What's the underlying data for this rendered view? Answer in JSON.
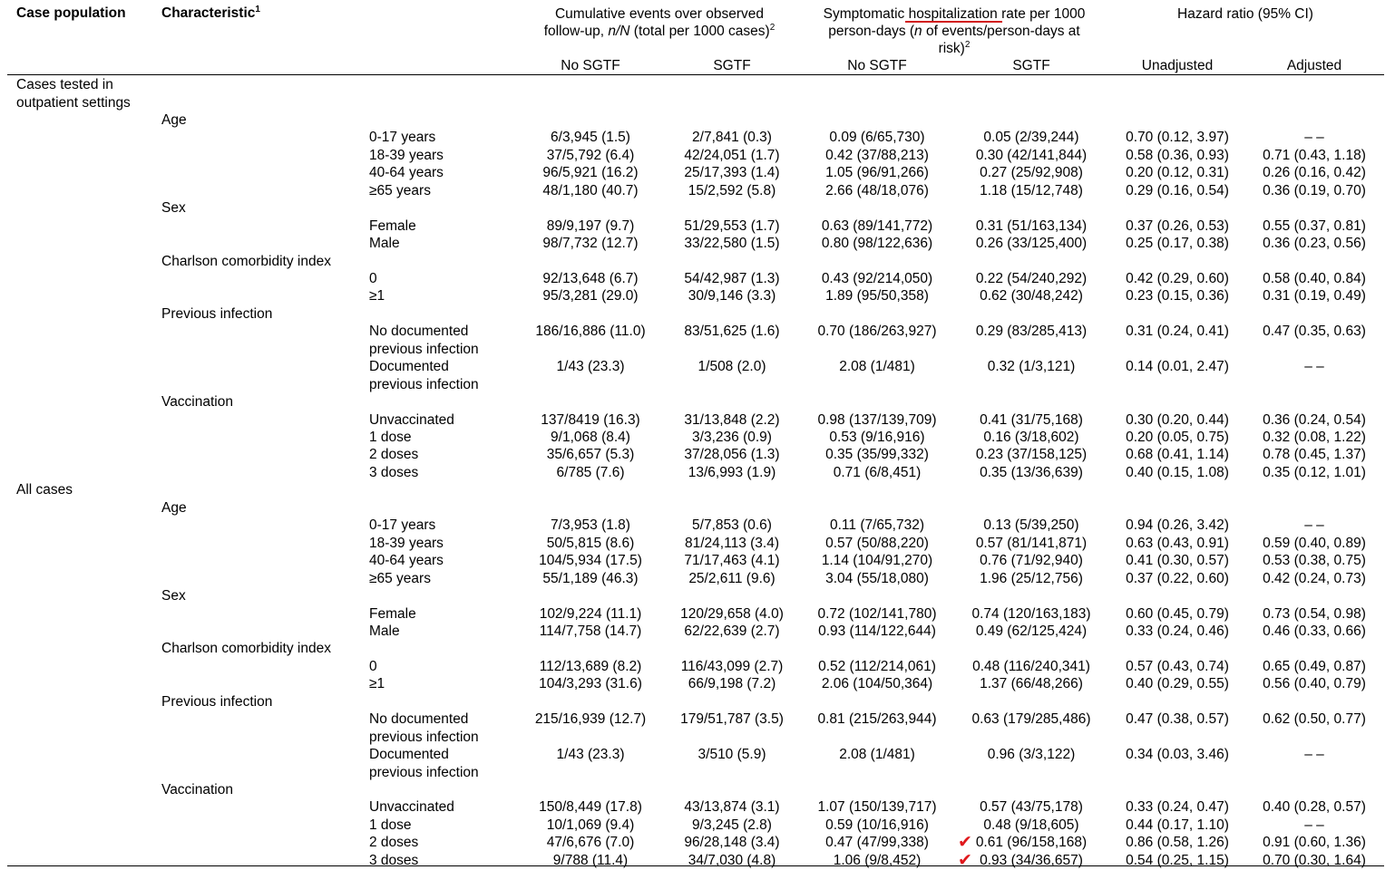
{
  "header": {
    "case_population": "Case population",
    "characteristic": "Characteristic",
    "characteristic_sup": "1",
    "cumulative_line1": "Cumulative events over observed",
    "cumulative_line2a": "follow-up, ",
    "cumulative_line2b": "n/N",
    "cumulative_line2c": " (total per 1000 cases)",
    "cumulative_sup": "2",
    "symp_line1a": "Symptomatic ",
    "symp_line1b": "hospitalization",
    "symp_line1c": " rate per 1000",
    "symp_line2a": "person-days (",
    "symp_line2b": "n",
    "symp_line2c": " of events/person-days at",
    "symp_line3": "risk)",
    "symp_sup": "2",
    "hazard": "Hazard ratio (95% CI)",
    "sub_no_sgtf_1": "No SGTF",
    "sub_sgtf_1": "SGTF",
    "sub_no_sgtf_2": "No SGTF",
    "sub_sgtf_2": "SGTF",
    "sub_unadjusted": "Unadjusted",
    "sub_adjusted": "Adjusted"
  },
  "rows": [
    {
      "pop": [
        "Cases tested in",
        "outpatient settings"
      ]
    },
    {
      "group": "Age"
    },
    {
      "level": [
        "0-17 years"
      ],
      "v": [
        "6/3,945 (1.5)",
        "2/7,841 (0.3)",
        "0.09 (6/65,730)",
        "0.05 (2/39,244)",
        "0.70 (0.12, 3.97)",
        "– –"
      ]
    },
    {
      "level": [
        "18-39 years"
      ],
      "v": [
        "37/5,792 (6.4)",
        "42/24,051 (1.7)",
        "0.42 (37/88,213)",
        "0.30 (42/141,844)",
        "0.58 (0.36, 0.93)",
        "0.71 (0.43, 1.18)"
      ]
    },
    {
      "level": [
        "40-64 years"
      ],
      "v": [
        "96/5,921 (16.2)",
        "25/17,393 (1.4)",
        "1.05 (96/91,266)",
        "0.27 (25/92,908)",
        "0.20 (0.12, 0.31)",
        "0.26 (0.16, 0.42)"
      ]
    },
    {
      "level": [
        "≥65 years"
      ],
      "v": [
        "48/1,180 (40.7)",
        "15/2,592 (5.8)",
        "2.66 (48/18,076)",
        "1.18 (15/12,748)",
        "0.29 (0.16, 0.54)",
        "0.36 (0.19, 0.70)"
      ]
    },
    {
      "group": "Sex"
    },
    {
      "level": [
        "Female"
      ],
      "v": [
        "89/9,197 (9.7)",
        "51/29,553 (1.7)",
        "0.63 (89/141,772)",
        "0.31 (51/163,134)",
        "0.37 (0.26, 0.53)",
        "0.55 (0.37, 0.81)"
      ]
    },
    {
      "level": [
        "Male"
      ],
      "v": [
        "98/7,732 (12.7)",
        "33/22,580 (1.5)",
        "0.80 (98/122,636)",
        "0.26 (33/125,400)",
        "0.25 (0.17, 0.38)",
        "0.36 (0.23, 0.56)"
      ]
    },
    {
      "group": "Charlson comorbidity index"
    },
    {
      "level": [
        "0"
      ],
      "v": [
        "92/13,648 (6.7)",
        "54/42,987 (1.3)",
        "0.43 (92/214,050)",
        "0.22 (54/240,292)",
        "0.42 (0.29, 0.60)",
        "0.58 (0.40, 0.84)"
      ]
    },
    {
      "level": [
        "≥1"
      ],
      "v": [
        "95/3,281 (29.0)",
        "30/9,146 (3.3)",
        "1.89 (95/50,358)",
        "0.62 (30/48,242)",
        "0.23 (0.15, 0.36)",
        "0.31 (0.19, 0.49)"
      ]
    },
    {
      "group": "Previous infection"
    },
    {
      "level": [
        "No documented",
        "previous infection"
      ],
      "v": [
        "186/16,886 (11.0)",
        "83/51,625 (1.6)",
        "0.70 (186/263,927)",
        "0.29 (83/285,413)",
        "0.31 (0.24, 0.41)",
        "0.47 (0.35, 0.63)"
      ]
    },
    {
      "level": [
        "Documented",
        "previous infection"
      ],
      "v": [
        "1/43 (23.3)",
        "1/508 (2.0)",
        "2.08 (1/481)",
        "0.32 (1/3,121)",
        "0.14 (0.01, 2.47)",
        "– –"
      ]
    },
    {
      "group": "Vaccination"
    },
    {
      "level": [
        "Unvaccinated"
      ],
      "v": [
        "137/8419 (16.3)",
        "31/13,848 (2.2)",
        "0.98 (137/139,709)",
        "0.41 (31/75,168)",
        "0.30 (0.20, 0.44)",
        "0.36 (0.24, 0.54)"
      ]
    },
    {
      "level": [
        "1 dose"
      ],
      "v": [
        "9/1,068 (8.4)",
        "3/3,236 (0.9)",
        "0.53 (9/16,916)",
        "0.16 (3/18,602)",
        "0.20 (0.05, 0.75)",
        "0.32 (0.08, 1.22)"
      ]
    },
    {
      "level": [
        "2 doses"
      ],
      "v": [
        "35/6,657 (5.3)",
        "37/28,056 (1.3)",
        "0.35 (35/99,332)",
        "0.23 (37/158,125)",
        "0.68 (0.41, 1.14)",
        "0.78 (0.45, 1.37)"
      ]
    },
    {
      "level": [
        "3 doses"
      ],
      "v": [
        "6/785 (7.6)",
        "13/6,993 (1.9)",
        "0.71 (6/8,451)",
        "0.35 (13/36,639)",
        "0.40 (0.15, 1.08)",
        "0.35 (0.12, 1.01)"
      ]
    },
    {
      "pop": [
        "All cases"
      ]
    },
    {
      "group": "Age"
    },
    {
      "level": [
        "0-17 years"
      ],
      "v": [
        "7/3,953 (1.8)",
        "5/7,853 (0.6)",
        "0.11 (7/65,732)",
        "0.13 (5/39,250)",
        "0.94 (0.26, 3.42)",
        "– –"
      ]
    },
    {
      "level": [
        "18-39 years"
      ],
      "v": [
        "50/5,815 (8.6)",
        "81/24,113 (3.4)",
        "0.57 (50/88,220)",
        "0.57 (81/141,871)",
        "0.63 (0.43, 0.91)",
        "0.59 (0.40, 0.89)"
      ]
    },
    {
      "level": [
        "40-64 years"
      ],
      "v": [
        "104/5,934 (17.5)",
        "71/17,463 (4.1)",
        "1.14 (104/91,270)",
        "0.76 (71/92,940)",
        "0.41 (0.30, 0.57)",
        "0.53 (0.38, 0.75)"
      ]
    },
    {
      "level": [
        "≥65 years"
      ],
      "v": [
        "55/1,189 (46.3)",
        "25/2,611 (9.6)",
        "3.04 (55/18,080)",
        "1.96 (25/12,756)",
        "0.37 (0.22, 0.60)",
        "0.42 (0.24, 0.73)"
      ]
    },
    {
      "group": "Sex"
    },
    {
      "level": [
        "Female"
      ],
      "v": [
        "102/9,224 (11.1)",
        "120/29,658 (4.0)",
        "0.72 (102/141,780)",
        "0.74 (120/163,183)",
        "0.60 (0.45, 0.79)",
        "0.73 (0.54, 0.98)"
      ]
    },
    {
      "level": [
        "Male"
      ],
      "v": [
        "114/7,758 (14.7)",
        "62/22,639 (2.7)",
        "0.93 (114/122,644)",
        "0.49 (62/125,424)",
        "0.33 (0.24, 0.46)",
        "0.46 (0.33, 0.66)"
      ]
    },
    {
      "group": "Charlson comorbidity index"
    },
    {
      "level": [
        "0"
      ],
      "v": [
        "112/13,689 (8.2)",
        "116/43,099 (2.7)",
        "0.52 (112/214,061)",
        "0.48 (116/240,341)",
        "0.57 (0.43, 0.74)",
        "0.65 (0.49, 0.87)"
      ]
    },
    {
      "level": [
        "≥1"
      ],
      "v": [
        "104/3,293 (31.6)",
        "66/9,198 (7.2)",
        "2.06 (104/50,364)",
        "1.37 (66/48,266)",
        "0.40 (0.29, 0.55)",
        "0.56 (0.40, 0.79)"
      ]
    },
    {
      "group": "Previous infection"
    },
    {
      "level": [
        "No documented",
        "previous infection"
      ],
      "v": [
        "215/16,939 (12.7)",
        "179/51,787 (3.5)",
        "0.81 (215/263,944)",
        "0.63 (179/285,486)",
        "0.47 (0.38, 0.57)",
        "0.62 (0.50, 0.77)"
      ]
    },
    {
      "level": [
        "Documented",
        "previous infection"
      ],
      "v": [
        "1/43 (23.3)",
        "3/510 (5.9)",
        "2.08 (1/481)",
        "0.96 (3/3,122)",
        "0.34 (0.03, 3.46)",
        "– –"
      ]
    },
    {
      "group": "Vaccination"
    },
    {
      "level": [
        "Unvaccinated"
      ],
      "v": [
        "150/8,449 (17.8)",
        "43/13,874 (3.1)",
        "1.07 (150/139,717)",
        "0.57 (43/75,178)",
        "0.33 (0.24, 0.47)",
        "0.40 (0.28, 0.57)"
      ]
    },
    {
      "level": [
        "1 dose"
      ],
      "v": [
        "10/1,069 (9.4)",
        "9/3,245 (2.8)",
        "0.59 (10/16,916)",
        "0.48 (9/18,605)",
        "0.44 (0.17, 1.10)",
        "– –"
      ]
    },
    {
      "level": [
        "2 doses"
      ],
      "v": [
        "47/6,676 (7.0)",
        "96/28,148 (3.4)",
        "0.47 (47/99,338)",
        "0.61 (96/158,168)",
        "0.86 (0.58, 1.26)",
        "0.91 (0.60, 1.36)"
      ],
      "check": true
    },
    {
      "level": [
        "3 doses"
      ],
      "v": [
        "9/788 (11.4)",
        "34/7,030 (4.8)",
        "1.06 (9/8,452)",
        "0.93 (34/36,657)",
        "0.54 (0.25, 1.15)",
        "0.70 (0.30, 1.64)"
      ],
      "check": true
    }
  ],
  "annotations": {
    "underline_color": "#d21a1a",
    "check_color": "#e0191d",
    "check_glyph": "✔"
  }
}
